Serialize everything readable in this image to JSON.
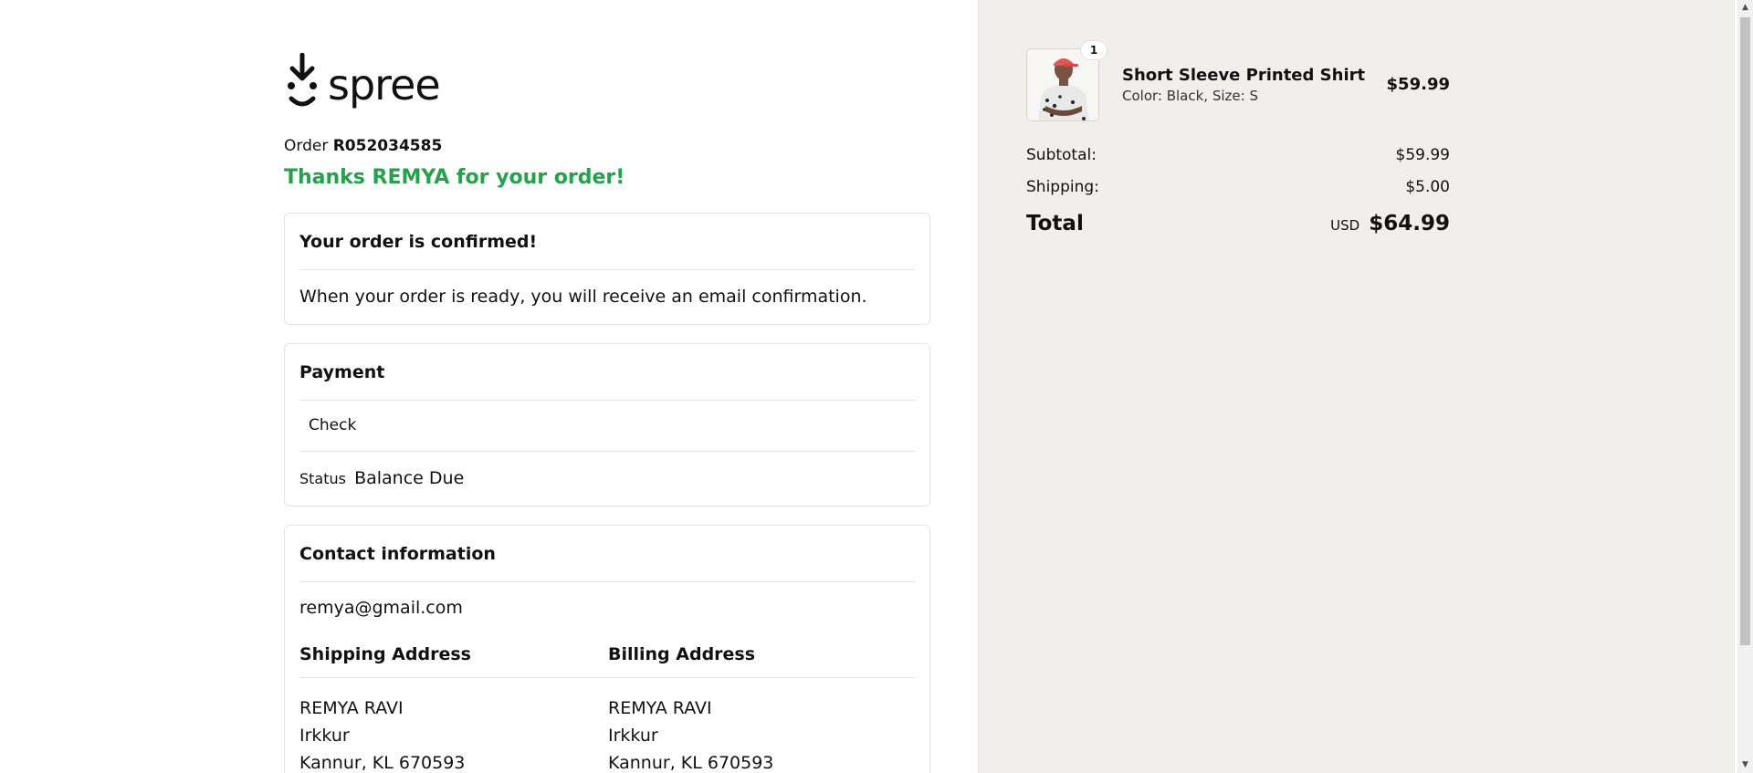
{
  "logo": {
    "text": "spree"
  },
  "order": {
    "prefix": "Order",
    "number": "R052034585"
  },
  "thanks": "Thanks REMYA for your order!",
  "confirmation": {
    "title": "Your order is confirmed!",
    "message": "When your order is ready, you will receive an email confirmation."
  },
  "payment": {
    "title": "Payment",
    "method": "Check",
    "status_label": "Status",
    "status_value": "Balance Due"
  },
  "contact": {
    "title": "Contact information",
    "email": "remya@gmail.com",
    "shipping_title": "Shipping Address",
    "billing_title": "Billing Address",
    "shipping": [
      "REMYA RAVI",
      "Irkkur",
      "Kannur, KL 670593"
    ],
    "billing": [
      "REMYA RAVI",
      "Irkkur",
      "Kannur, KL 670593"
    ]
  },
  "summary": {
    "item": {
      "name": "Short Sleeve Printed Shirt",
      "variant": "Color: Black, Size: S",
      "price": "$59.99",
      "quantity": "1"
    },
    "subtotal_label": "Subtotal:",
    "subtotal": "$59.99",
    "shipping_label": "Shipping:",
    "shipping": "$5.00",
    "total_label": "Total",
    "currency": "USD",
    "total": "$64.99"
  },
  "colors": {
    "accent_green": "#22a24a",
    "summary_bg": "#f0efeb"
  }
}
